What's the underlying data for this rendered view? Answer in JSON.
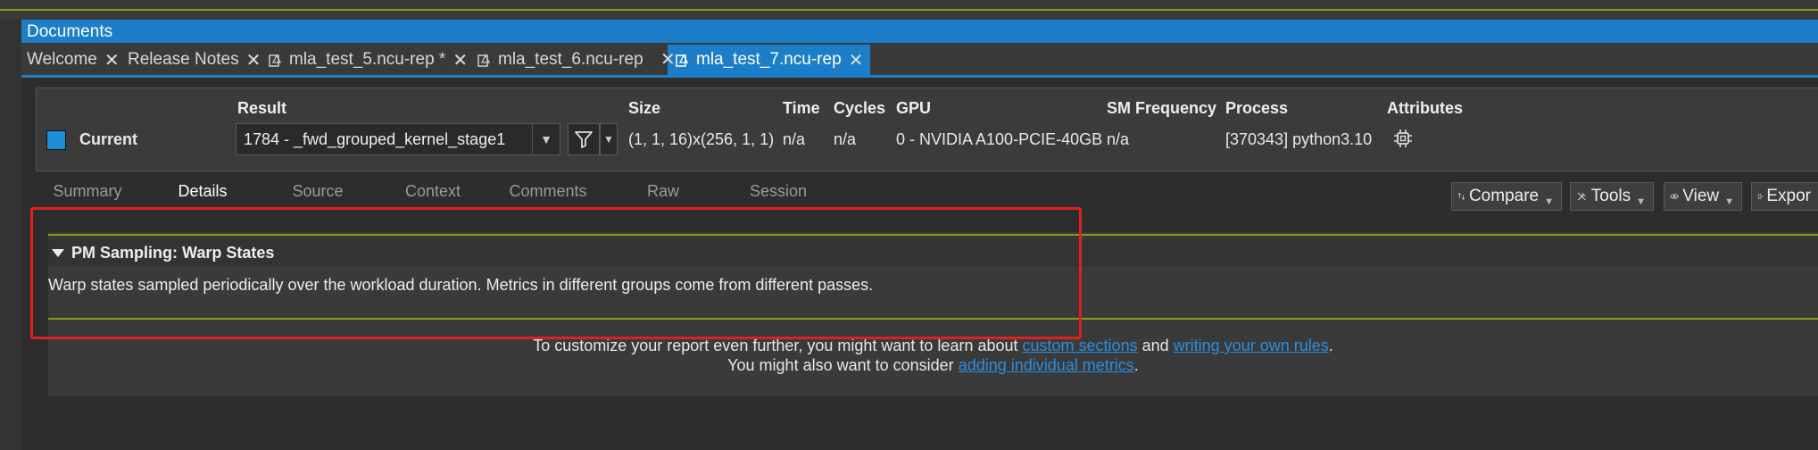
{
  "documents_bar": {
    "title": "Documents"
  },
  "tabs": [
    {
      "label": "Welcome",
      "close": "✕"
    },
    {
      "label": "Release Notes",
      "close": "✕"
    },
    {
      "label": "mla_test_5.ncu-rep *",
      "close": "✕"
    },
    {
      "label": "mla_test_6.ncu-rep",
      "close": "✕"
    },
    {
      "label": "mla_test_7.ncu-rep",
      "close": "✕"
    }
  ],
  "header": {
    "current_label": "Current",
    "current_color": "#1c8fd6",
    "columns": {
      "result": "Result",
      "size": "Size",
      "time": "Time",
      "cycles": "Cycles",
      "gpu": "GPU",
      "sm_frequency": "SM Frequency",
      "process": "Process",
      "attributes": "Attributes"
    },
    "values": {
      "result": "1784 - _fwd_grouped_kernel_stage1",
      "size": "(1, 1, 16)x(256, 1, 1)",
      "time": "n/a",
      "cycles": "n/a",
      "gpu": "0 - NVIDIA A100-PCIE-40GB",
      "sm_frequency": "n/a",
      "process": "[370343] python3.10"
    }
  },
  "subtabs": [
    "Summary",
    "Details",
    "Source",
    "Context",
    "Comments",
    "Raw",
    "Session"
  ],
  "toolbar": {
    "compare": "Compare",
    "tools": "Tools",
    "view": "View",
    "export": "Expor"
  },
  "section": {
    "title": "PM Sampling: Warp States",
    "description": "Warp states sampled periodically over the workload duration. Metrics in different groups come from different passes."
  },
  "footer": {
    "line1_pre": "To customize your report even further, you might want to learn about",
    "link_custom": "custom sections",
    "and": "and",
    "link_rules": "writing your own rules",
    "line2_pre": "You might also want to consider",
    "link_metrics": "adding individual metrics"
  },
  "colors": {
    "accent": "#1c7ec9",
    "section_line": "#7fa21e",
    "highlight_box": "#e02020",
    "link": "#2a8fe0"
  }
}
